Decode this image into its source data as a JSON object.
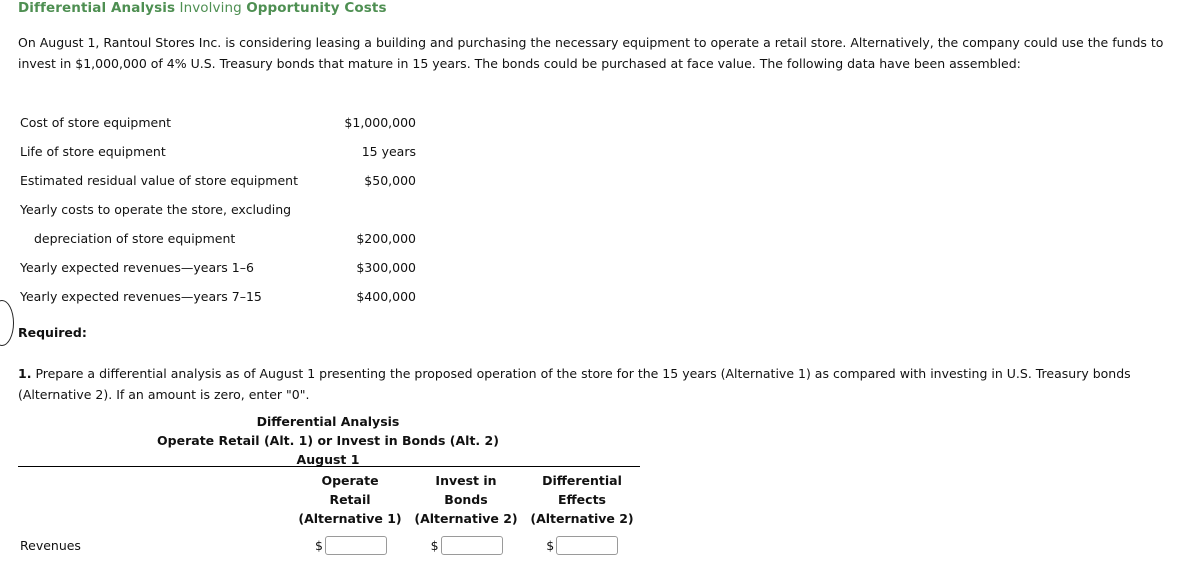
{
  "title": {
    "part1": "Differential Analysis",
    "part2": "Involving",
    "part3": "Opportunity Costs"
  },
  "intro": "On August 1, Rantoul Stores Inc. is considering leasing a building and purchasing the necessary equipment to operate a retail store. Alternatively, the company could use the funds to invest in $1,000,000 of 4% U.S. Treasury bonds that mature in 15 years. The bonds could be purchased at face value. The following data have been assembled:",
  "facts": [
    {
      "label": "Cost of store equipment",
      "value": "$1,000,000",
      "indent": false
    },
    {
      "label": "Life of store equipment",
      "value": "15 years",
      "indent": false
    },
    {
      "label": "Estimated residual value of store equipment",
      "value": "$50,000",
      "indent": false
    },
    {
      "label": "Yearly costs to operate the store, excluding",
      "value": "",
      "indent": false
    },
    {
      "label": "depreciation of store equipment",
      "value": "$200,000",
      "indent": true
    },
    {
      "label": "Yearly expected revenues—years 1–6",
      "value": "$300,000",
      "indent": false
    },
    {
      "label": "Yearly expected revenues—years 7–15",
      "value": "$400,000",
      "indent": false
    }
  ],
  "required_label": "Required:",
  "requirement": {
    "number": "1.",
    "text": "Prepare a differential analysis as of August 1 presenting the proposed operation of the store for the 15 years (Alternative 1) as compared with investing in U.S. Treasury bonds (Alternative 2). If an amount is zero, enter \"0\"."
  },
  "analysis": {
    "line1": "Differential Analysis",
    "line2": "Operate Retail (Alt. 1) or Invest in Bonds (Alt. 2)",
    "line3": "August 1",
    "columns": [
      {
        "l1": "Operate",
        "l2": "Retail",
        "l3": "(Alternative 1)"
      },
      {
        "l1": "Invest in",
        "l2": "Bonds",
        "l3": "(Alternative 2)"
      },
      {
        "l1": "Differential",
        "l2": "Effects",
        "l3": "(Alternative 2)"
      }
    ],
    "rows": [
      {
        "label": "Revenues",
        "cells": [
          {
            "currency": "$",
            "value": ""
          },
          {
            "currency": "$",
            "value": ""
          },
          {
            "currency": "$",
            "value": ""
          }
        ]
      }
    ]
  }
}
